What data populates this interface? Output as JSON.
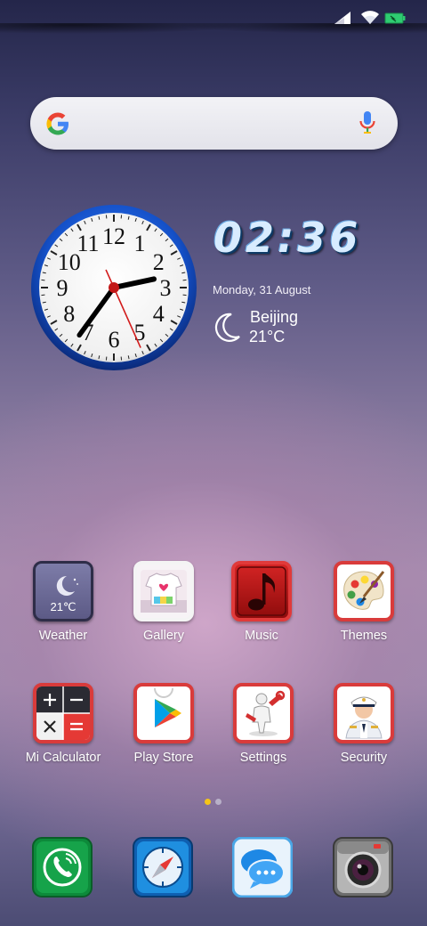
{
  "status_bar": {
    "icons": [
      "signal-icon",
      "wifi-icon",
      "battery-icon"
    ],
    "battery_color": "#2ecc71"
  },
  "search": {
    "logo": "google-g-icon",
    "mic": "mic-icon"
  },
  "clock_widget": {
    "analog": {
      "numbers": [
        "12",
        "1",
        "2",
        "3",
        "4",
        "5",
        "6",
        "7",
        "8",
        "9",
        "10",
        "11"
      ],
      "hour": 2,
      "minute": 36,
      "second": 26,
      "ring_color": "#1450c8"
    },
    "digital_time": "02:36",
    "date": "Monday, 31 August",
    "weather_city": "Beijing",
    "weather_temp": "21°C",
    "weather_icon": "moon-icon"
  },
  "apps": [
    {
      "label": "Weather",
      "icon": "weather-icon",
      "badge_text": "21℃"
    },
    {
      "label": "Gallery",
      "icon": "gallery-icon"
    },
    {
      "label": "Music",
      "icon": "music-icon"
    },
    {
      "label": "Themes",
      "icon": "themes-icon"
    },
    {
      "label": "Mi Calculator",
      "icon": "calculator-icon"
    },
    {
      "label": "Play Store",
      "icon": "play-store-icon"
    },
    {
      "label": "Settings",
      "icon": "settings-icon"
    },
    {
      "label": "Security",
      "icon": "security-icon"
    }
  ],
  "page_indicator": {
    "pages": 2,
    "active": 1,
    "active_color": "#f5c518",
    "inactive_color": "#b8b0c8"
  },
  "dock": [
    {
      "icon": "phone-icon"
    },
    {
      "icon": "browser-icon"
    },
    {
      "icon": "messages-icon"
    },
    {
      "icon": "camera-icon"
    }
  ]
}
